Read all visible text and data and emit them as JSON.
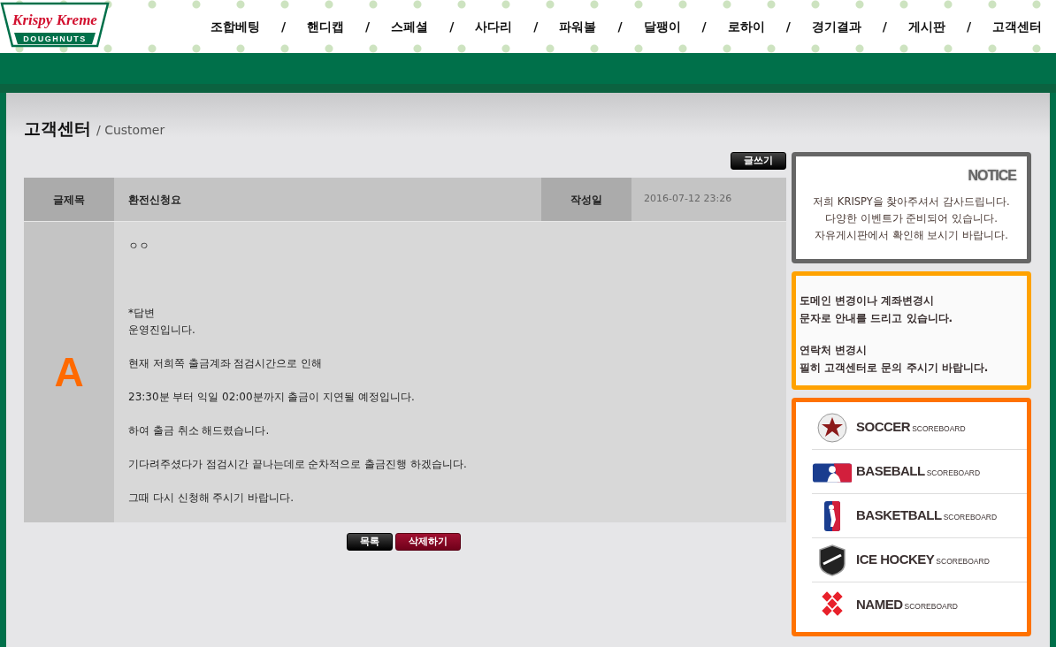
{
  "logo": {
    "brand": "Krispy Kreme",
    "tagline": "DOUGHNUTS"
  },
  "nav": [
    {
      "kind": "link",
      "label": "조합베팅"
    },
    {
      "kind": "separator",
      "label": "/"
    },
    {
      "kind": "link",
      "label": "핸디캡"
    },
    {
      "kind": "separator",
      "label": "/"
    },
    {
      "kind": "link",
      "label": "스페셜"
    },
    {
      "kind": "separator",
      "label": "/"
    },
    {
      "kind": "link",
      "label": "사다리"
    },
    {
      "kind": "separator",
      "label": "/"
    },
    {
      "kind": "link",
      "label": "파워볼"
    },
    {
      "kind": "separator",
      "label": "/"
    },
    {
      "kind": "link",
      "label": "달팽이"
    },
    {
      "kind": "separator",
      "label": "/"
    },
    {
      "kind": "link",
      "label": "로하이"
    },
    {
      "kind": "separator",
      "label": "/"
    },
    {
      "kind": "link",
      "label": "경기결과"
    },
    {
      "kind": "separator",
      "label": "/"
    },
    {
      "kind": "link",
      "label": "게시판"
    },
    {
      "kind": "separator",
      "label": "/"
    },
    {
      "kind": "link",
      "label": "고객센터"
    }
  ],
  "page_title": {
    "main": "고객센터",
    "sub": "/ Customer"
  },
  "write_button": "글쓰기",
  "post": {
    "subject_label": "글제목",
    "subject": "환전신청요",
    "date_label": "작성일",
    "date": "2016-07-12 23:26",
    "answer_mark": "A",
    "paragraphs": [
      [
        "ㅇㅇ"
      ],
      [
        "*답변",
        "운영진입니다."
      ],
      [
        "현재 저희쪽 출금계좌 점검시간으로 인해"
      ],
      [
        "23:30분 부터 익일 02:00분까지 출금이 지연될 예정입니다."
      ],
      [
        "하여 출금 취소 해드렸습니다."
      ],
      [
        "기다려주셨다가 점검시간 끝나는데로 순차적으로 출금진행 하겠습니다."
      ],
      [
        "그때 다시 신청해 주시기 바랍니다."
      ]
    ]
  },
  "buttons": [
    {
      "kind": "list",
      "label": "목록"
    },
    {
      "kind": "delete",
      "label": "삭제하기"
    }
  ],
  "notice": {
    "title": "NOTICE",
    "lines": [
      "저희 KRISPY을 찾아주셔서 감사드립니다.",
      "다양한 이벤트가 준비되어 있습니다.",
      "자유게시판에서 확인해 보시기 바랍니다."
    ]
  },
  "info": [
    [
      "도메인 변경이나 계좌변경시",
      "문자로 안내를 드리고 있습니다."
    ],
    [
      "연락처 변경시",
      "필히 고객센터로 문의 주시기 바랍니다."
    ]
  ],
  "scoreboards": [
    {
      "kind": "soccer",
      "name": "SOCCER",
      "suffix": "SCOREBOARD"
    },
    {
      "kind": "baseball",
      "name": "BASEBALL",
      "suffix": "SCOREBOARD"
    },
    {
      "kind": "basketball",
      "name": "BASKETBALL",
      "suffix": "SCOREBOARD"
    },
    {
      "kind": "hockey",
      "name": "ICE HOCKEY",
      "suffix": "SCOREBOARD"
    },
    {
      "kind": "named",
      "name": "NAMED",
      "suffix": "SCOREBOARD"
    }
  ]
}
